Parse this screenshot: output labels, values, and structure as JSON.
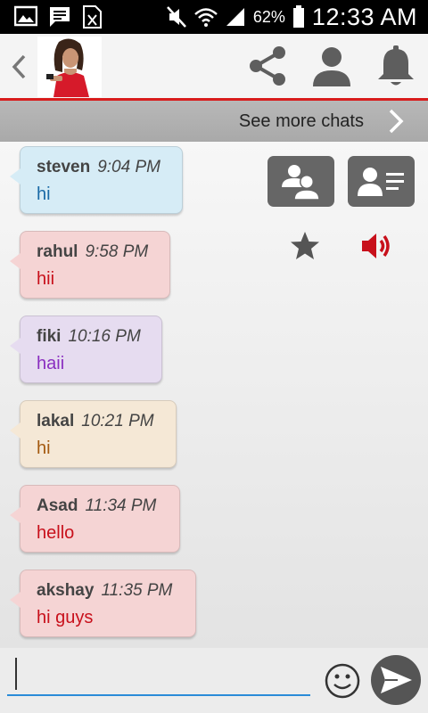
{
  "status_bar": {
    "battery_percent": "62%",
    "time": "12:33 AM",
    "icons": [
      "image-icon",
      "message-icon",
      "sim-icon",
      "mute-icon",
      "wifi-icon",
      "signal-icon",
      "battery-icon"
    ]
  },
  "header": {
    "icons": [
      "back-icon",
      "profile-photo",
      "share-icon",
      "person-icon",
      "bell-icon"
    ],
    "accent_color": "#d81b1b"
  },
  "more_bar": {
    "label": "See more chats"
  },
  "messages": [
    {
      "name": "steven",
      "time": "9:04 PM",
      "text": "hi",
      "bg": "#d6ecf6",
      "text_color": "#1a6aa6"
    },
    {
      "name": "rahul",
      "time": "9:58 PM",
      "text": "hii",
      "bg": "#f5d4d4",
      "text_color": "#c8101b"
    },
    {
      "name": "fiki",
      "time": "10:16 PM",
      "text": "haii",
      "bg": "#e6dcf0",
      "text_color": "#8a2ec0"
    },
    {
      "name": "lakal",
      "time": "10:21 PM",
      "text": "hi",
      "bg": "#f5e8d6",
      "text_color": "#a45a10"
    },
    {
      "name": "Asad",
      "time": "11:34 PM",
      "text": "hello",
      "bg": "#f5d4d4",
      "text_color": "#c8101b"
    },
    {
      "name": "akshay",
      "time": "11:35 PM",
      "text": "hi guys",
      "bg": "#f5d4d4",
      "text_color": "#c8101b"
    }
  ],
  "side_actions": {
    "icons": [
      "group-chat-icon",
      "contact-card-icon",
      "star-icon",
      "speaker-icon"
    ],
    "speaker_color": "#c8101b"
  },
  "composer": {
    "input_value": "",
    "icons": [
      "smiley-icon",
      "send-icon"
    ],
    "underline_color": "#2a8bd8"
  }
}
